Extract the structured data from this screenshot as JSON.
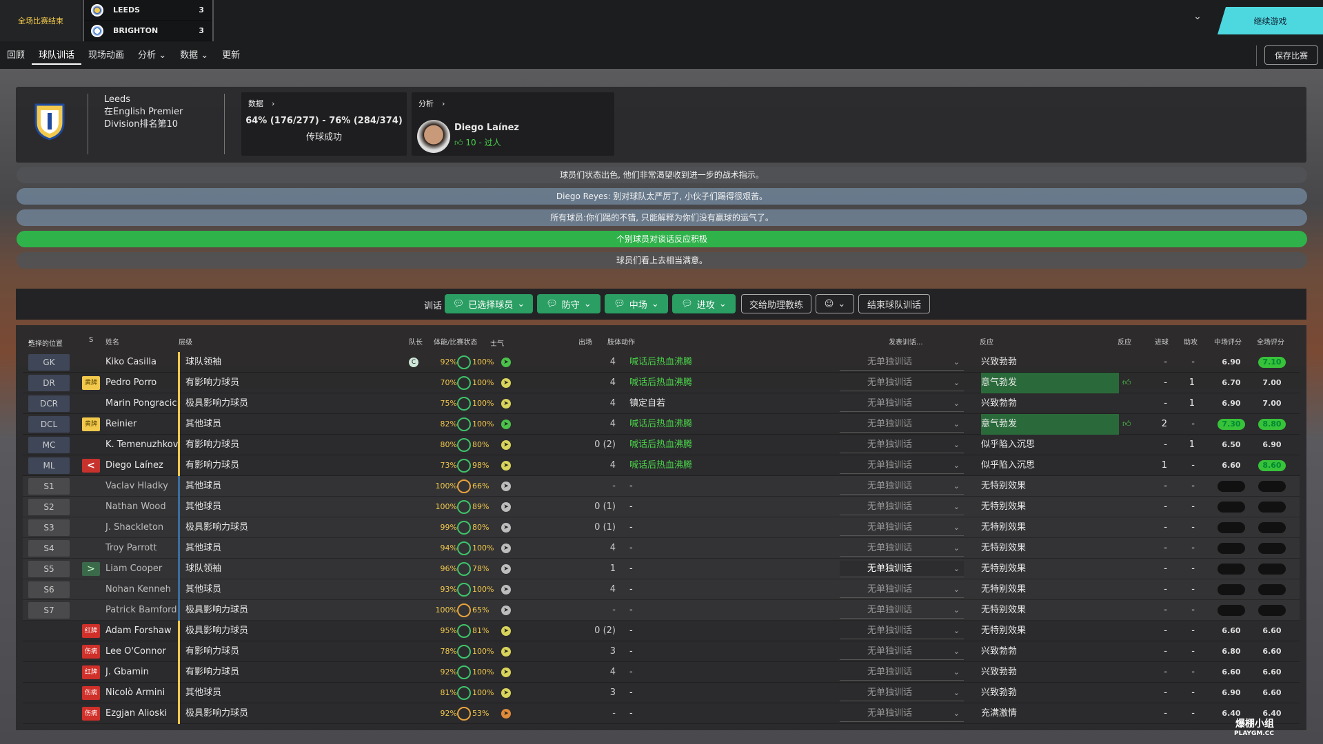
{
  "header": {
    "status": "全场比赛结束",
    "home": {
      "name": "LEEDS",
      "score": "3"
    },
    "away": {
      "name": "BRIGHTON",
      "score": "3"
    },
    "continue_label": "继续游戏",
    "save_label": "保存比赛"
  },
  "nav": [
    "回顾",
    "球队训话",
    "现场动画",
    "分析",
    "数据",
    "更新"
  ],
  "club": {
    "name": "Leeds",
    "rank_line1": "在English Premier",
    "rank_line2": "Division排名第10"
  },
  "stats_card": {
    "label": "数据",
    "value": "64% (176/277) - 76% (284/374)",
    "desc": "传球成功"
  },
  "analysis_card": {
    "label": "分析",
    "player": "Diego Laínez",
    "detail": "10 - 过人"
  },
  "messages": [
    "球员们状态出色, 他们非常渴望收到进一步的战术指示。",
    "Diego Reyes: 别对球队太严厉了, 小伙子们踢得很艰苦。",
    "所有球员:你们踢的不错, 只能解释为你们没有赢球的运气了。",
    "个别球员对谈话反应积极",
    "球员们看上去相当满意。"
  ],
  "teamtalk": {
    "label": "训话",
    "buttons": [
      "已选择球员",
      "防守",
      "中场",
      "进攻"
    ],
    "assistant": "交给助理教练",
    "end": "结束球队训话"
  },
  "columns": {
    "pos": "选择的位置",
    "s": "S",
    "name": "姓名",
    "tier": "层级",
    "cap": "队长",
    "fit": "体能/比赛状态",
    "morale": "士气",
    "apps": "出场",
    "body": "肢体动作",
    "indiv": "发表训话...",
    "react": "反应",
    "react2": "反应",
    "goals": "进球",
    "assists": "助攻",
    "half_rating": "中场评分",
    "full_rating": "全场评分"
  },
  "rows": [
    {
      "pos": "GK",
      "flag": "",
      "name": "Kiko Casilla",
      "tier": "球队领袖",
      "cap": "C",
      "fit": "92%",
      "cond": "100%",
      "morale": "g",
      "apps": "4",
      "body": "喊话后热血沸腾",
      "indiv": "无单独训话",
      "react": "兴致勃勃",
      "goals": "-",
      "assists": "-",
      "half": "6.90",
      "full": "7.10"
    },
    {
      "pos": "DR",
      "flag": "黄牌",
      "name": "Pedro Porro",
      "tier": "有影响力球员",
      "fit": "70%",
      "cond": "100%",
      "morale": "y",
      "apps": "4",
      "body": "喊话后热血沸腾",
      "indiv": "无单独训话",
      "react": "意气勃发",
      "goals": "-",
      "assists": "1",
      "half": "6.70",
      "full": "7.00"
    },
    {
      "pos": "DCR",
      "flag": "",
      "name": "Marin Pongracic",
      "tier": "极具影响力球员",
      "fit": "75%",
      "cond": "100%",
      "morale": "y",
      "apps": "4",
      "body": "镇定自若",
      "indiv": "无单独训话",
      "react": "兴致勃勃",
      "goals": "-",
      "assists": "1",
      "half": "6.90",
      "full": "7.00"
    },
    {
      "pos": "DCL",
      "flag": "黄牌",
      "name": "Reinier",
      "tier": "其他球员",
      "fit": "82%",
      "cond": "100%",
      "morale": "g",
      "apps": "4",
      "body": "喊话后热血沸腾",
      "indiv": "无单独训话",
      "react": "意气勃发",
      "goals": "2",
      "assists": "-",
      "half": "7.30",
      "full": "8.80"
    },
    {
      "pos": "MC",
      "flag": "",
      "name": "K. Temenuzhkov",
      "tier": "有影响力球员",
      "fit": "80%",
      "cond": "80%",
      "morale": "y",
      "apps": "0 (2)",
      "body": "喊话后热血沸腾",
      "indiv": "无单独训话",
      "react": "似乎陷入沉思",
      "goals": "-",
      "assists": "1",
      "half": "6.50",
      "full": "6.90"
    },
    {
      "pos": "ML",
      "flag": "<",
      "name": "Diego Laínez",
      "tier": "有影响力球员",
      "fit": "73%",
      "cond": "98%",
      "morale": "y",
      "apps": "4",
      "body": "喊话后热血沸腾",
      "indiv": "无单独训话",
      "react": "似乎陷入沉思",
      "goals": "1",
      "assists": "-",
      "half": "6.60",
      "full": "8.60"
    },
    {
      "pos": "S1",
      "flag": "",
      "name": "Vaclav Hladky",
      "tier": "其他球员",
      "fit": "100%",
      "cond": "66%",
      "morale": "gr",
      "apps": "-",
      "body": "-",
      "indiv": "无单独训话",
      "react": "无特别效果",
      "goals": "-",
      "assists": "-",
      "half": "",
      "full": ""
    },
    {
      "pos": "S2",
      "flag": "",
      "name": "Nathan Wood",
      "tier": "其他球员",
      "fit": "100%",
      "cond": "89%",
      "morale": "gr",
      "apps": "0 (1)",
      "body": "-",
      "indiv": "无单独训话",
      "react": "无特别效果",
      "goals": "-",
      "assists": "-",
      "half": "",
      "full": ""
    },
    {
      "pos": "S3",
      "flag": "",
      "name": "J. Shackleton",
      "tier": "极具影响力球员",
      "fit": "99%",
      "cond": "80%",
      "morale": "gr",
      "apps": "0 (1)",
      "body": "-",
      "indiv": "无单独训话",
      "react": "无特别效果",
      "goals": "-",
      "assists": "-",
      "half": "",
      "full": ""
    },
    {
      "pos": "S4",
      "flag": "",
      "name": "Troy Parrott",
      "tier": "其他球员",
      "fit": "94%",
      "cond": "100%",
      "morale": "gr",
      "apps": "4",
      "body": "-",
      "indiv": "无单独训话",
      "react": "无特别效果",
      "goals": "-",
      "assists": "-",
      "half": "",
      "full": ""
    },
    {
      "pos": "S5",
      "flag": ">",
      "name": "Liam Cooper",
      "tier": "球队领袖",
      "fit": "96%",
      "cond": "78%",
      "morale": "gr",
      "apps": "1",
      "body": "-",
      "indiv": "无单独训话",
      "react": "无特别效果",
      "goals": "-",
      "assists": "-",
      "half": "",
      "full": ""
    },
    {
      "pos": "S6",
      "flag": "",
      "name": "Nohan Kenneh",
      "tier": "其他球员",
      "fit": "93%",
      "cond": "100%",
      "morale": "gr",
      "apps": "4",
      "body": "-",
      "indiv": "无单独训话",
      "react": "无特别效果",
      "goals": "-",
      "assists": "-",
      "half": "",
      "full": ""
    },
    {
      "pos": "S7",
      "flag": "",
      "name": "Patrick Bamford",
      "tier": "极具影响力球员",
      "fit": "100%",
      "cond": "65%",
      "morale": "gr",
      "apps": "-",
      "body": "-",
      "indiv": "无单独训话",
      "react": "无特别效果",
      "goals": "-",
      "assists": "-",
      "half": "",
      "full": ""
    },
    {
      "pos": "",
      "flag": "红牌",
      "name": "Adam Forshaw",
      "tier": "极具影响力球员",
      "fit": "95%",
      "cond": "81%",
      "morale": "y",
      "apps": "0 (2)",
      "body": "-",
      "indiv": "无单独训话",
      "react": "无特别效果",
      "goals": "-",
      "assists": "-",
      "half": "6.60",
      "full": "6.60"
    },
    {
      "pos": "",
      "flag": "伤病",
      "name": "Lee O'Connor",
      "tier": "有影响力球员",
      "fit": "78%",
      "cond": "100%",
      "morale": "y",
      "apps": "3",
      "body": "-",
      "indiv": "无单独训话",
      "react": "兴致勃勃",
      "goals": "-",
      "assists": "-",
      "half": "6.80",
      "full": "6.60"
    },
    {
      "pos": "",
      "flag": "红牌",
      "name": "J. Gbamin",
      "tier": "有影响力球员",
      "fit": "92%",
      "cond": "100%",
      "morale": "y",
      "apps": "4",
      "body": "-",
      "indiv": "无单独训话",
      "react": "兴致勃勃",
      "goals": "-",
      "assists": "-",
      "half": "6.60",
      "full": "6.60"
    },
    {
      "pos": "",
      "flag": "伤病",
      "name": "Nicolò Armini",
      "tier": "其他球员",
      "fit": "81%",
      "cond": "100%",
      "morale": "y",
      "apps": "3",
      "body": "-",
      "indiv": "无单独训话",
      "react": "兴致勃勃",
      "goals": "-",
      "assists": "-",
      "half": "6.90",
      "full": "6.60"
    },
    {
      "pos": "",
      "flag": "伤病",
      "name": "Ezgjan Alioski",
      "tier": "极具影响力球员",
      "fit": "92%",
      "cond": "53%",
      "morale": "o",
      "apps": "-",
      "body": "-",
      "indiv": "无单独训话",
      "react": "充满激情",
      "goals": "-",
      "assists": "-",
      "half": "6.40",
      "full": "6.40"
    }
  ],
  "watermark": {
    "line1": "爆棚小组",
    "line2": "PLAYGM.CC"
  },
  "colors": {
    "accent": "#4dd8e0",
    "green": "#2fb24a",
    "yellow": "#f2c94c"
  }
}
